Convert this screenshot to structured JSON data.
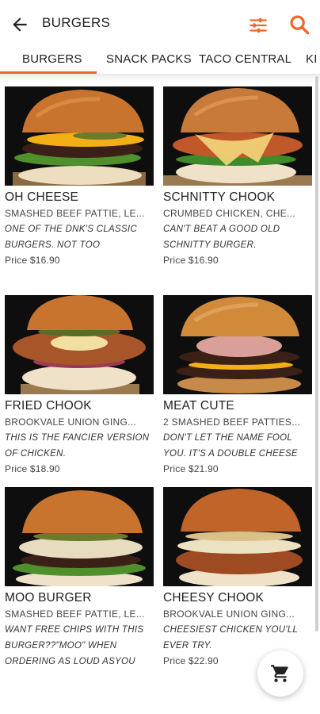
{
  "header": {
    "title": "BURGERS",
    "back_icon": "arrow-left-icon",
    "filter_icon": "sliders-icon",
    "search_icon": "search-icon",
    "accent_color": "#f0672c"
  },
  "tabs": [
    {
      "label": "BURGERS",
      "active": true
    },
    {
      "label": "SNACK PACKS",
      "active": false
    },
    {
      "label": "TACO CENTRAL",
      "active": false
    },
    {
      "label": "KI",
      "active": false
    }
  ],
  "products": [
    {
      "name": "OH CHEESE",
      "ingredients": "SMASHED BEEF PATTIE, LE...",
      "description": "ONE OF THE DNK'S CLASSIC BURGERS. NOT TOO HUNGRY??? THIS IS YOUR GO TO BURGER",
      "price": "Price $16.90"
    },
    {
      "name": "SCHNITTY CHOOK",
      "ingredients": "CRUMBED CHICKEN, CHE...",
      "description": "CAN'T BEAT A GOOD OLD SCHNITTY BURGER.",
      "price": "Price $16.90"
    },
    {
      "name": "FRIED CHOOK",
      "ingredients": "BROOKVALE UNION GING...",
      "description": "THIS IS THE FANCIER VERSION OF CHICKEN.",
      "price": "Price $18.90"
    },
    {
      "name": "MEAT CUTE",
      "ingredients": "2 SMASHED BEEF PATTIES...",
      "description": "DON'T LET THE NAME FOOL YOU. IT'S A DOUBLE CHEESE BURGER.",
      "price": "Price $21.90"
    },
    {
      "name": "MOO BURGER",
      "ingredients": "SMASHED BEEF PATTIE, LE...",
      "description": "WANT FREE CHIPS WITH THIS BURGER??\"MOO\" WHEN ORDERING AS LOUD ASYOU CAN, WE'LL SHOUT YOU CHIPS",
      "price": ""
    },
    {
      "name": "CHEESY CHOOK",
      "ingredients": "BROOKVALE UNION GING...",
      "description": "CHEESIEST CHICKEN YOU'LL EVER TRY.",
      "price": "Price $22.90"
    }
  ],
  "cart": {
    "icon": "cart-icon"
  }
}
